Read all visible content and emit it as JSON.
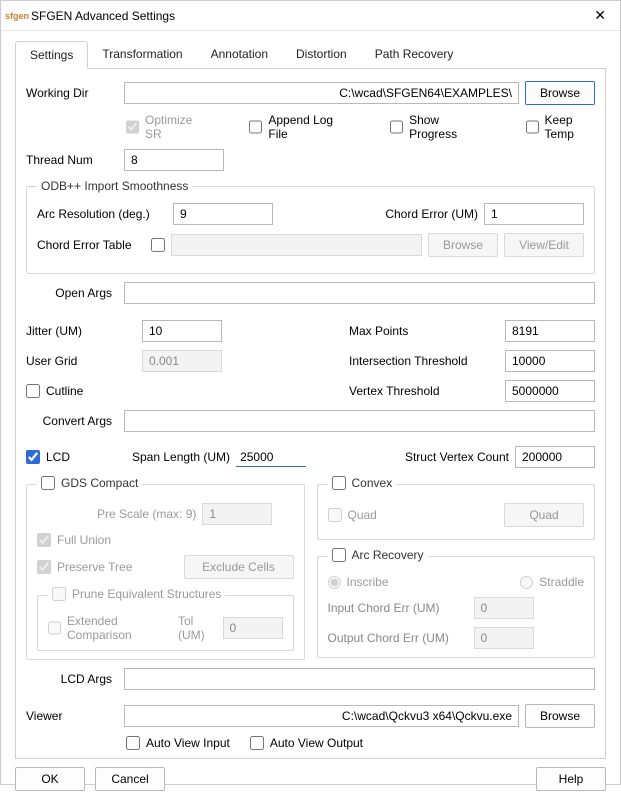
{
  "window": {
    "title": "SFGEN Advanced Settings",
    "icon_label": "sfgen"
  },
  "tabs": {
    "settings": "Settings",
    "transformation": "Transformation",
    "annotation": "Annotation",
    "distortion": "Distortion",
    "path_recovery": "Path Recovery"
  },
  "working_dir": {
    "label": "Working Dir",
    "value": "C:\\wcad\\SFGEN64\\EXAMPLES\\",
    "browse": "Browse"
  },
  "options_row": {
    "optimize_sr": "Optimize SR",
    "append_log": "Append Log File",
    "show_progress": "Show Progress",
    "keep_temp": "Keep Temp"
  },
  "thread_num": {
    "label": "Thread Num",
    "value": "8"
  },
  "odb": {
    "legend": "ODB++ Import Smoothness",
    "arc_res_label": "Arc Resolution (deg.)",
    "arc_res_value": "9",
    "chord_err_label": "Chord Error (UM)",
    "chord_err_value": "1",
    "chord_table_label": "Chord Error Table",
    "browse": "Browse",
    "view_edit": "View/Edit"
  },
  "open_args": {
    "label": "Open Args",
    "value": ""
  },
  "mid": {
    "jitter_label": "Jitter (UM)",
    "jitter_value": "10",
    "user_grid_label": "User Grid",
    "user_grid_value": "0.001",
    "cutline_label": "Cutline",
    "max_points_label": "Max Points",
    "max_points_value": "8191",
    "inter_thresh_label": "Intersection Threshold",
    "inter_thresh_value": "10000",
    "vertex_thresh_label": "Vertex Threshold",
    "vertex_thresh_value": "5000000",
    "convert_args_label": "Convert Args",
    "convert_args_value": ""
  },
  "lcd": {
    "lcd_label": "LCD",
    "span_len_label": "Span Length (UM)",
    "span_len_value": "25000",
    "svc_label": "Struct Vertex Count",
    "svc_value": "200000",
    "gds_compact_label": "GDS Compact",
    "pre_scale_label": "Pre Scale (max: 9)",
    "pre_scale_value": "1",
    "full_union_label": "Full Union",
    "preserve_tree_label": "Preserve Tree",
    "exclude_cells_btn": "Exclude Cells",
    "prune_legend": "Prune Equivalent Structures",
    "ext_comp_label": "Extended Comparison",
    "tol_label": "Tol (UM)",
    "tol_value": "0",
    "convex_label": "Convex",
    "quad_label": "Quad",
    "quad_btn": "Quad",
    "arc_rec_label": "Arc Recovery",
    "inscribe_label": "Inscribe",
    "straddle_label": "Straddle",
    "in_chord_label": "Input Chord Err (UM)",
    "in_chord_value": "0",
    "out_chord_label": "Output Chord Err (UM)",
    "out_chord_value": "0",
    "lcd_args_label": "LCD Args",
    "lcd_args_value": ""
  },
  "viewer": {
    "label": "Viewer",
    "value": "C:\\wcad\\Qckvu3 x64\\Qckvu.exe",
    "browse": "Browse",
    "auto_in": "Auto View Input",
    "auto_out": "Auto View Output"
  },
  "footer": {
    "ok": "OK",
    "cancel": "Cancel",
    "help": "Help"
  }
}
